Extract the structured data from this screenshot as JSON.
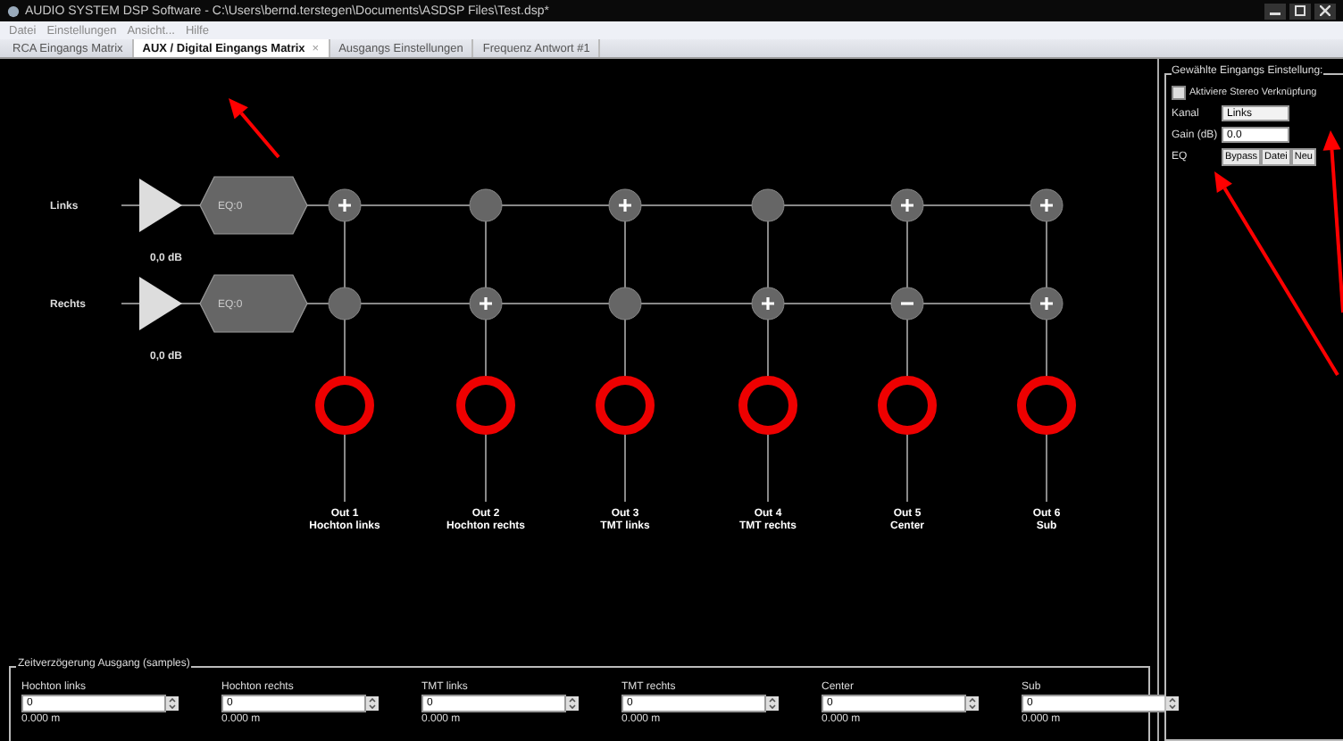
{
  "window": {
    "title": "AUDIO SYSTEM DSP Software - C:\\Users\\bernd.terstegen\\Documents\\ASDSP Files\\Test.dsp*"
  },
  "menu": [
    "Datei",
    "Einstellungen",
    "Ansicht...",
    "Hilfe"
  ],
  "tabs": [
    {
      "label": "RCA Eingangs Matrix",
      "selected": false,
      "closable": false
    },
    {
      "label": "AUX / Digital Eingangs Matrix",
      "selected": true,
      "closable": true,
      "close": "×"
    },
    {
      "label": "Ausgangs Einstellungen",
      "selected": false,
      "closable": false
    },
    {
      "label": "Frequenz Antwort #1",
      "selected": false,
      "closable": false
    }
  ],
  "matrix": {
    "inputs": [
      {
        "name": "Links",
        "gain": "0,0 dB",
        "eq": "EQ:0",
        "routes": [
          {
            "active": true,
            "inverted": false
          },
          {
            "active": false
          },
          {
            "active": true,
            "inverted": false
          },
          {
            "active": false
          },
          {
            "active": true,
            "inverted": false
          },
          {
            "active": true,
            "inverted": false
          }
        ]
      },
      {
        "name": "Rechts",
        "gain": "0,0 dB",
        "eq": "EQ:0",
        "routes": [
          {
            "active": false
          },
          {
            "active": true,
            "inverted": false
          },
          {
            "active": false
          },
          {
            "active": true,
            "inverted": false
          },
          {
            "active": true,
            "inverted": true
          },
          {
            "active": true,
            "inverted": false
          }
        ]
      }
    ],
    "outputs": [
      {
        "number": "Out 1",
        "name": "Hochton links"
      },
      {
        "number": "Out 2",
        "name": "Hochton rechts"
      },
      {
        "number": "Out 3",
        "name": "TMT links"
      },
      {
        "number": "Out 4",
        "name": "TMT rechts"
      },
      {
        "number": "Out 5",
        "name": "Center"
      },
      {
        "number": "Out 6",
        "name": "Sub"
      }
    ]
  },
  "delay": {
    "title": "Zeitverzögerung Ausgang (samples)",
    "channels": [
      {
        "label": "Hochton links",
        "value": "0",
        "distance": "0.000 m"
      },
      {
        "label": "Hochton rechts",
        "value": "0",
        "distance": "0.000 m"
      },
      {
        "label": "TMT links",
        "value": "0",
        "distance": "0.000 m"
      },
      {
        "label": "TMT rechts",
        "value": "0",
        "distance": "0.000 m"
      },
      {
        "label": "Center",
        "value": "0",
        "distance": "0.000 m"
      },
      {
        "label": "Sub",
        "value": "0",
        "distance": "0.000 m"
      }
    ]
  },
  "input_settings": {
    "title": "Gewählte Eingangs Einstellung:",
    "stereo_link": {
      "label": "Aktiviere Stereo Verknüpfung",
      "checked": false
    },
    "channel": {
      "label": "Kanal",
      "value": "Links"
    },
    "gain": {
      "label": "Gain (dB)",
      "value": "0.0"
    },
    "eq": {
      "label": "EQ",
      "buttons": [
        "Bypass",
        "Datei",
        "Neu"
      ]
    }
  }
}
